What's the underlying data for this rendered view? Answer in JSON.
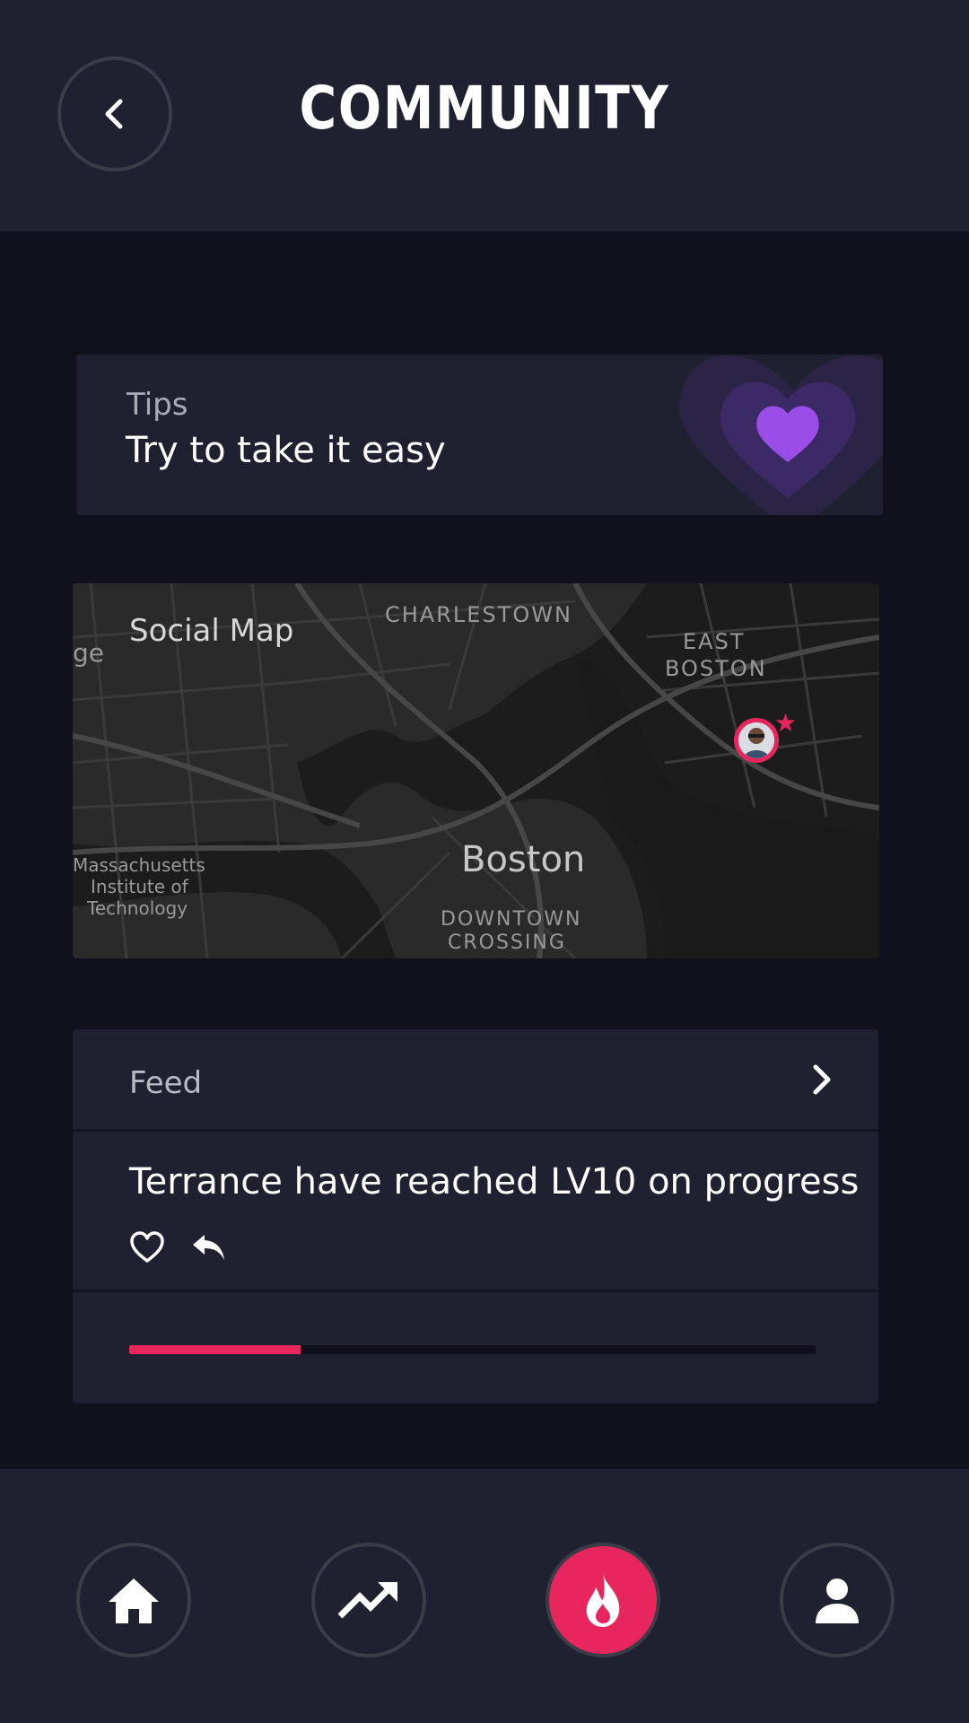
{
  "header": {
    "title": "COMMUNITY",
    "back_icon": "chevron-left-icon"
  },
  "tips": {
    "label": "Tips",
    "text": "Try to take it easy",
    "icon": "heart-icon",
    "accent": "#9b4de8"
  },
  "social_map": {
    "title": "Social Map",
    "places": {
      "charlestown": "CHARLESTOWN",
      "east_boston_1": "EAST",
      "east_boston_2": "BOSTON",
      "boston": "Boston",
      "mit_1": "Massachusetts",
      "mit_2": "Institute of",
      "mit_3": "Technology",
      "downtown_1": "DOWNTOWN",
      "downtown_2": "CROSSING",
      "edge_fragment": "ge"
    },
    "marker": {
      "icon": "user-avatar-icon",
      "badge_icon": "star-icon"
    }
  },
  "feed": {
    "label": "Feed",
    "chevron_icon": "chevron-right-icon",
    "items": [
      {
        "text": "Terrance have reached LV10 on progress",
        "like_icon": "heart-outline-icon",
        "reply_icon": "reply-icon"
      }
    ],
    "progress": 0.25
  },
  "nav": {
    "items": [
      {
        "name": "home",
        "icon": "home-icon",
        "active": false
      },
      {
        "name": "trends",
        "icon": "trending-up-icon",
        "active": false
      },
      {
        "name": "community",
        "icon": "flame-icon",
        "active": true
      },
      {
        "name": "profile",
        "icon": "user-icon",
        "active": false
      }
    ]
  },
  "colors": {
    "background": "#10111c",
    "surface": "#1f2130",
    "accent": "#e8265e",
    "tip_heart": "#9b4de8"
  }
}
